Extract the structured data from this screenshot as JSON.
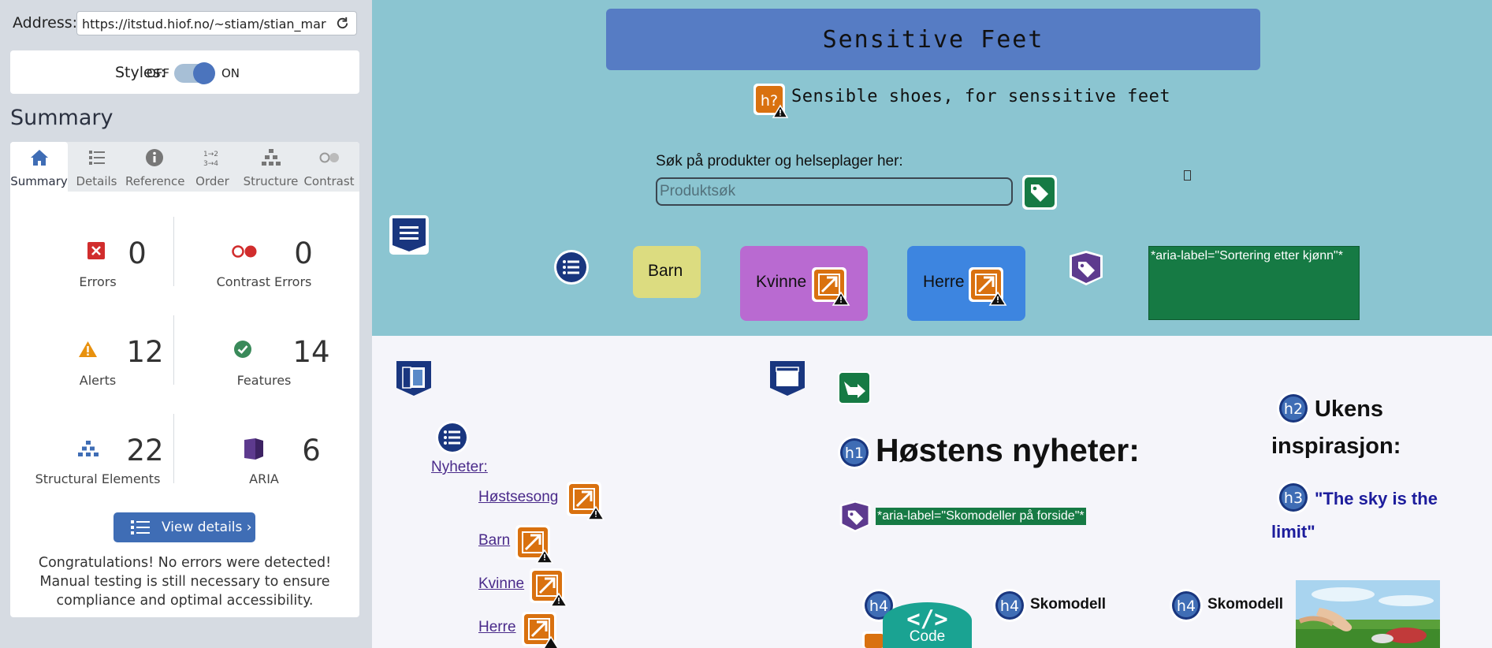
{
  "sidebar": {
    "address_label": "Address:",
    "address_value": "https://itstud.hiof.no/~stiam/stian_marthinsen",
    "styles_label": "Styles:",
    "styles_off": "OFF",
    "styles_on": "ON",
    "heading": "Summary",
    "tabs": [
      {
        "label": "Summary",
        "icon": "home-icon"
      },
      {
        "label": "Details",
        "icon": "list-icon"
      },
      {
        "label": "Reference",
        "icon": "info-icon"
      },
      {
        "label": "Order",
        "icon": "order-icon"
      },
      {
        "label": "Structure",
        "icon": "structure-icon"
      },
      {
        "label": "Contrast",
        "icon": "contrast-icon"
      }
    ],
    "stats": {
      "errors": {
        "value": "0",
        "label": "Errors"
      },
      "contrast_errors": {
        "value": "0",
        "label": "Contrast Errors"
      },
      "alerts": {
        "value": "12",
        "label": "Alerts"
      },
      "features": {
        "value": "14",
        "label": "Features"
      },
      "structural": {
        "value": "22",
        "label": "Structural Elements"
      },
      "aria": {
        "value": "6",
        "label": "ARIA"
      }
    },
    "view_details": "View details ›",
    "congrats": "Congratulations! No errors were detected! Manual testing is still necessary to ensure compliance and optimal accessibility."
  },
  "site": {
    "title": "Sensitive Feet",
    "tagline": "Sensible shoes, for senssitive feet",
    "search_label": "Søk på produkter og helseplager her:",
    "search_placeholder": "Produktsøk",
    "nav": {
      "barn": "Barn",
      "kvinne": "Kvinne",
      "herre": "Herre"
    },
    "aria_label_sort": "*aria-label=\"Sortering etter kjønn\"*",
    "aria_label_models": "*aria-label=\"Skomodeller på forside\"*",
    "links": {
      "nyheter": "Nyheter:",
      "hostsesong": "Høstsesong",
      "barn": "Barn",
      "kvinne": "Kvinne",
      "herre": "Herre"
    },
    "h1": "Høstens nyheter:",
    "h2": "Ukens inspirasjon:",
    "h3": "\"The sky is the limit\"",
    "h4_a": "Skomodell",
    "h4_b": "Skomodell",
    "code_badge": "Code",
    "heading_badges": {
      "h1": "h1",
      "h2": "h2",
      "h3": "h3",
      "h4": "h4",
      "h_unknown": "h?"
    }
  },
  "colors": {
    "wave_blue": "#3f6db5",
    "alert_orange": "#d9710f",
    "feature_green": "#167a44",
    "aria_purple": "#5d3a8e",
    "structure_navy": "#19367f"
  }
}
